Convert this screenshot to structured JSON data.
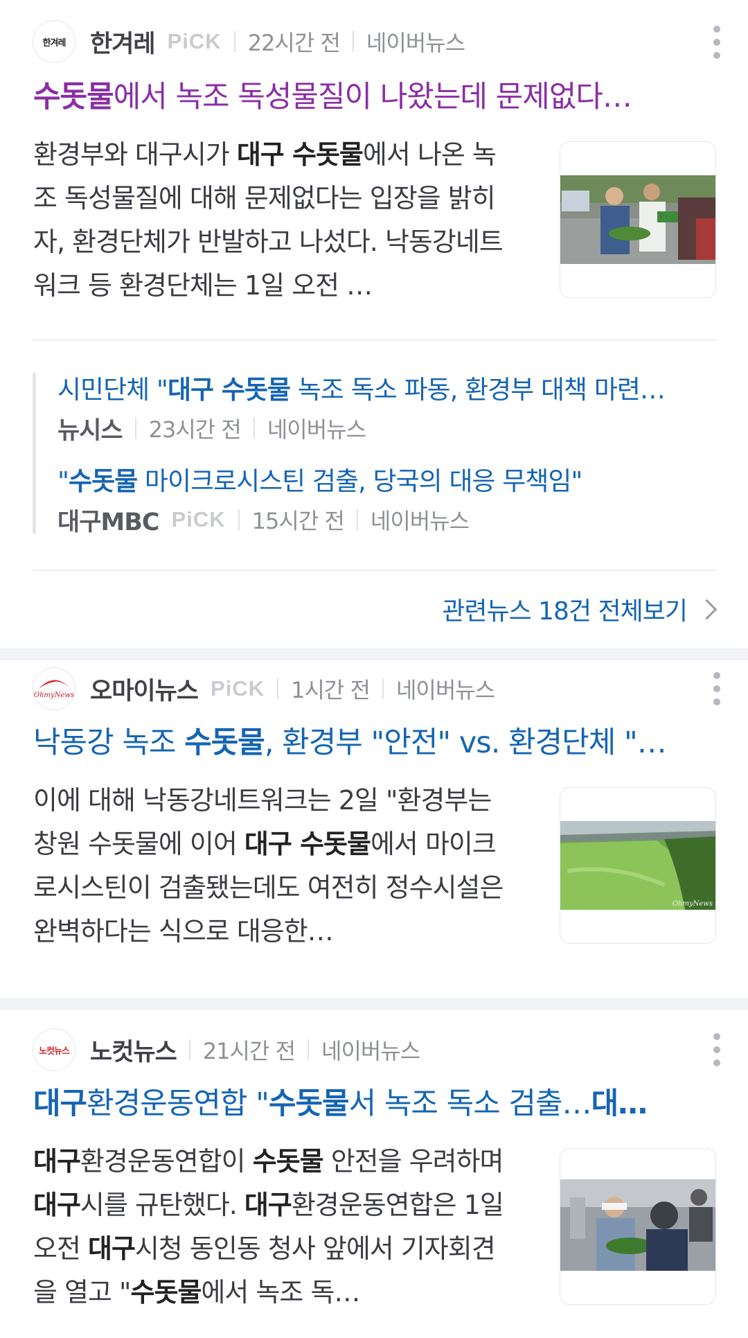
{
  "articles": [
    {
      "press": "한겨레",
      "logo_text": "한겨레",
      "pick": "PiCK",
      "time": "22시간 전",
      "portal": "네이버뉴스",
      "title_parts": [
        {
          "text": "수돗물",
          "bold": true
        },
        {
          "text": "에서 녹조 독성물질이 나왔는데 문제없다…",
          "bold": false
        }
      ],
      "desc_parts": [
        {
          "text": "환경부와 대구시가 ",
          "bold": false
        },
        {
          "text": "대구 수돗물",
          "bold": true
        },
        {
          "text": "에서 나온 녹조 독성물질에 대해 문제없다는 입장을 밝히자, 환경단체가 반발하고 나섰다. 낙동강네트워크 등 환경단체는 1일 오전 …",
          "bold": false
        }
      ],
      "thumb_icon": "protest-photo",
      "related": [
        {
          "title_parts": [
            {
              "text": "시민단체 \"",
              "bold": false
            },
            {
              "text": "대구 수돗물",
              "bold": true
            },
            {
              "text": " 녹조 독소 파동, 환경부 대책 마련…",
              "bold": false
            }
          ],
          "press": "뉴시스",
          "pick": "",
          "time": "23시간 전",
          "portal": "네이버뉴스"
        },
        {
          "title_parts": [
            {
              "text": "\"",
              "bold": false
            },
            {
              "text": "수돗물",
              "bold": true
            },
            {
              "text": " 마이크로시스틴 검출, 당국의 대응 무책임\"",
              "bold": false
            }
          ],
          "press": "대구MBC",
          "pick": "PiCK",
          "time": "15시간 전",
          "portal": "네이버뉴스"
        }
      ],
      "more_label": "관련뉴스 18건 전체보기"
    },
    {
      "press": "오마이뉴스",
      "logo_text": "OhmyNews",
      "pick": "PiCK",
      "time": "1시간 전",
      "portal": "네이버뉴스",
      "title_parts": [
        {
          "text": "낙동강 녹조 ",
          "bold": false
        },
        {
          "text": "수돗물",
          "bold": true
        },
        {
          "text": ", 환경부 \"안전\" vs. 환경단체 \"…",
          "bold": false
        }
      ],
      "desc_parts": [
        {
          "text": "이에 대해 낙동강네트워크는 2일 \"환경부는 창원 수돗물에 이어 ",
          "bold": false
        },
        {
          "text": "대구 수돗물",
          "bold": true
        },
        {
          "text": "에서 마이크로시스틴이 검출됐는데도 여전히 정수시설은 완벽하다는 식으로 대응한…",
          "bold": false
        }
      ],
      "thumb_icon": "river-algae-photo",
      "thumb_watermark": "OhmyNews"
    },
    {
      "press": "노컷뉴스",
      "logo_text": "노컷뉴스",
      "pick": "",
      "time": "21시간 전",
      "portal": "네이버뉴스",
      "title_parts": [
        {
          "text": "대구",
          "bold": true
        },
        {
          "text": "환경운동연합 \"",
          "bold": false
        },
        {
          "text": "수돗물",
          "bold": true
        },
        {
          "text": "서 녹조 독소 검출…",
          "bold": false
        },
        {
          "text": "대…",
          "bold": true
        }
      ],
      "desc_parts": [
        {
          "text": "대구",
          "bold": true
        },
        {
          "text": "환경운동연합이 ",
          "bold": false
        },
        {
          "text": "수돗물",
          "bold": true
        },
        {
          "text": " 안전을 우려하며 ",
          "bold": false
        },
        {
          "text": "대구",
          "bold": true
        },
        {
          "text": "시를 규탄했다. ",
          "bold": false
        },
        {
          "text": "대구",
          "bold": true
        },
        {
          "text": "환경운동연합은 1일 오전 ",
          "bold": false
        },
        {
          "text": "대구",
          "bold": true
        },
        {
          "text": "시청 동인동 청사 앞에서 기자회견을 열고 \"",
          "bold": false
        },
        {
          "text": "수돗물",
          "bold": true
        },
        {
          "text": "에서 녹조 독…",
          "bold": false
        }
      ],
      "thumb_icon": "press-conference-photo"
    }
  ]
}
